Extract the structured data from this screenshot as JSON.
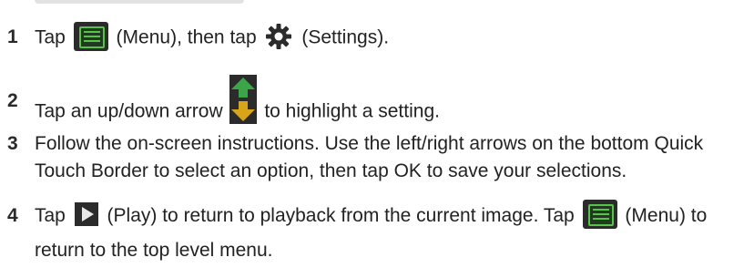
{
  "steps": [
    {
      "num": "1",
      "t1": "Tap",
      "t2": "(Menu), then tap",
      "t3": "(Settings)."
    },
    {
      "num": "2",
      "t1": "Tap an up/down arrow",
      "t2": "to highlight a setting."
    },
    {
      "num": "3",
      "text": "Follow the on-screen instructions. Use the left/right arrows on the bottom Quick Touch Border to select an option, then tap OK to save your selections."
    },
    {
      "num": "4",
      "t1": "Tap",
      "t2": "(Play) to return to playback from the current image. Tap",
      "t3": "(Menu) to return to the top level menu."
    }
  ],
  "icons": {
    "menu": "menu-icon",
    "settings": "gear-icon",
    "updown": "up-down-arrow-icon",
    "play": "play-icon"
  },
  "colors": {
    "text": "#222222",
    "icon_bg": "#2b2b2b",
    "menu_green": "#59c24a",
    "arrow_top": "#3aa648",
    "arrow_bottom": "#d8a41a"
  }
}
